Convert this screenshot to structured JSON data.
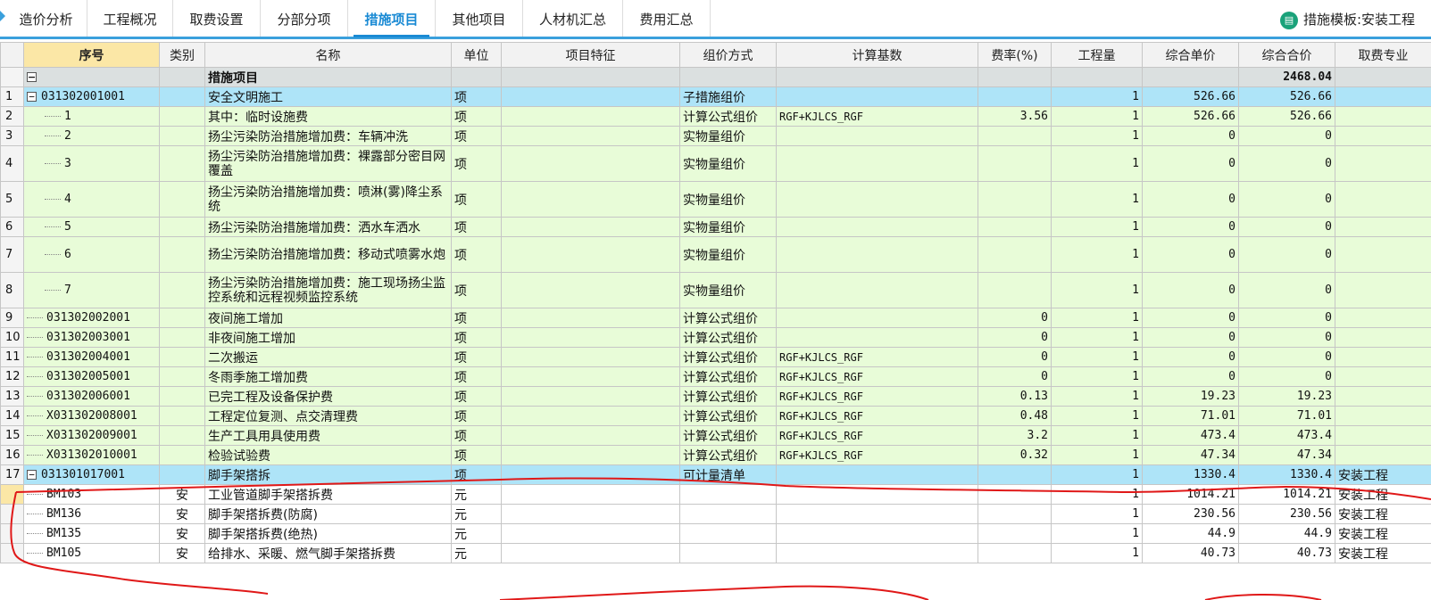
{
  "tabs": [
    "造价分析",
    "工程概况",
    "取费设置",
    "分部分项",
    "措施项目",
    "其他项目",
    "人材机汇总",
    "费用汇总"
  ],
  "active_tab": 4,
  "template_label": "措施模板:安装工程",
  "columns": [
    "序号",
    "类别",
    "名称",
    "单位",
    "项目特征",
    "组价方式",
    "计算基数",
    "费率(%)",
    "工程量",
    "综合单价",
    "综合合价",
    "取费专业"
  ],
  "header_row": {
    "name": "措施项目",
    "total": "2468.04"
  },
  "rows": [
    {
      "rn": "1",
      "code": "031302001001",
      "cat": "",
      "name": "安全文明施工",
      "unit": "项",
      "method": "子措施组价",
      "base": "",
      "rate": "",
      "qty": "1",
      "price": "526.66",
      "total": "526.66",
      "major": ""
    },
    {
      "rn": "2",
      "code": "1",
      "cat": "",
      "name": "其中：临时设施费",
      "unit": "项",
      "method": "计算公式组价",
      "base": "RGF+KJLCS_RGF",
      "rate": "3.56",
      "qty": "1",
      "price": "526.66",
      "total": "526.66",
      "major": ""
    },
    {
      "rn": "3",
      "code": "2",
      "cat": "",
      "name": "扬尘污染防治措施增加费：车辆冲洗",
      "unit": "项",
      "method": "实物量组价",
      "base": "",
      "rate": "",
      "qty": "1",
      "price": "0",
      "total": "0",
      "major": ""
    },
    {
      "rn": "4",
      "code": "3",
      "cat": "",
      "name": "扬尘污染防治措施增加费：裸露部分密目网覆盖",
      "unit": "项",
      "method": "实物量组价",
      "base": "",
      "rate": "",
      "qty": "1",
      "price": "0",
      "total": "0",
      "major": ""
    },
    {
      "rn": "5",
      "code": "4",
      "cat": "",
      "name": "扬尘污染防治措施增加费：喷淋(雾)降尘系统",
      "unit": "项",
      "method": "实物量组价",
      "base": "",
      "rate": "",
      "qty": "1",
      "price": "0",
      "total": "0",
      "major": ""
    },
    {
      "rn": "6",
      "code": "5",
      "cat": "",
      "name": "扬尘污染防治措施增加费：洒水车洒水",
      "unit": "项",
      "method": "实物量组价",
      "base": "",
      "rate": "",
      "qty": "1",
      "price": "0",
      "total": "0",
      "major": ""
    },
    {
      "rn": "7",
      "code": "6",
      "cat": "",
      "name": "扬尘污染防治措施增加费：移动式喷雾水炮",
      "unit": "项",
      "method": "实物量组价",
      "base": "",
      "rate": "",
      "qty": "1",
      "price": "0",
      "total": "0",
      "major": ""
    },
    {
      "rn": "8",
      "code": "7",
      "cat": "",
      "name": "扬尘污染防治措施增加费：施工现场扬尘监控系统和远程视频监控系统",
      "unit": "项",
      "method": "实物量组价",
      "base": "",
      "rate": "",
      "qty": "1",
      "price": "0",
      "total": "0",
      "major": ""
    },
    {
      "rn": "9",
      "code": "031302002001",
      "cat": "",
      "name": "夜间施工增加",
      "unit": "项",
      "method": "计算公式组价",
      "base": "",
      "rate": "0",
      "qty": "1",
      "price": "0",
      "total": "0",
      "major": ""
    },
    {
      "rn": "10",
      "code": "031302003001",
      "cat": "",
      "name": "非夜间施工增加",
      "unit": "项",
      "method": "计算公式组价",
      "base": "",
      "rate": "0",
      "qty": "1",
      "price": "0",
      "total": "0",
      "major": ""
    },
    {
      "rn": "11",
      "code": "031302004001",
      "cat": "",
      "name": "二次搬运",
      "unit": "项",
      "method": "计算公式组价",
      "base": "RGF+KJLCS_RGF",
      "rate": "0",
      "qty": "1",
      "price": "0",
      "total": "0",
      "major": ""
    },
    {
      "rn": "12",
      "code": "031302005001",
      "cat": "",
      "name": "冬雨季施工增加费",
      "unit": "项",
      "method": "计算公式组价",
      "base": "RGF+KJLCS_RGF",
      "rate": "0",
      "qty": "1",
      "price": "0",
      "total": "0",
      "major": ""
    },
    {
      "rn": "13",
      "code": "031302006001",
      "cat": "",
      "name": "已完工程及设备保护费",
      "unit": "项",
      "method": "计算公式组价",
      "base": "RGF+KJLCS_RGF",
      "rate": "0.13",
      "qty": "1",
      "price": "19.23",
      "total": "19.23",
      "major": ""
    },
    {
      "rn": "14",
      "code": "X031302008001",
      "cat": "",
      "name": "工程定位复测、点交清理费",
      "unit": "项",
      "method": "计算公式组价",
      "base": "RGF+KJLCS_RGF",
      "rate": "0.48",
      "qty": "1",
      "price": "71.01",
      "total": "71.01",
      "major": ""
    },
    {
      "rn": "15",
      "code": "X031302009001",
      "cat": "",
      "name": "生产工具用具使用费",
      "unit": "项",
      "method": "计算公式组价",
      "base": "RGF+KJLCS_RGF",
      "rate": "3.2",
      "qty": "1",
      "price": "473.4",
      "total": "473.4",
      "major": ""
    },
    {
      "rn": "16",
      "code": "X031302010001",
      "cat": "",
      "name": "检验试验费",
      "unit": "项",
      "method": "计算公式组价",
      "base": "RGF+KJLCS_RGF",
      "rate": "0.32",
      "qty": "1",
      "price": "47.34",
      "total": "47.34",
      "major": ""
    },
    {
      "rn": "17",
      "code": "031301017001",
      "cat": "",
      "name": "脚手架搭拆",
      "unit": "项",
      "method": "可计量清单",
      "base": "",
      "rate": "",
      "qty": "1",
      "price": "1330.4",
      "total": "1330.4",
      "major": "安装工程"
    },
    {
      "rn": "",
      "code": "BM103",
      "cat": "安",
      "name": "工业管道脚手架搭拆费",
      "unit": "元",
      "method": "",
      "base": "",
      "rate": "",
      "qty": "1",
      "price": "1014.21",
      "total": "1014.21",
      "major": "安装工程"
    },
    {
      "rn": "",
      "code": "BM136",
      "cat": "安",
      "name": "脚手架搭拆费(防腐)",
      "unit": "元",
      "method": "",
      "base": "",
      "rate": "",
      "qty": "1",
      "price": "230.56",
      "total": "230.56",
      "major": "安装工程"
    },
    {
      "rn": "",
      "code": "BM135",
      "cat": "安",
      "name": "脚手架搭拆费(绝热)",
      "unit": "元",
      "method": "",
      "base": "",
      "rate": "",
      "qty": "1",
      "price": "44.9",
      "total": "44.9",
      "major": "安装工程"
    },
    {
      "rn": "",
      "code": "BM105",
      "cat": "安",
      "name": "给排水、采暖、燃气脚手架搭拆费",
      "unit": "元",
      "method": "",
      "base": "",
      "rate": "",
      "qty": "1",
      "price": "40.73",
      "total": "40.73",
      "major": "安装工程"
    }
  ],
  "colors": {
    "accent": "#1a8ad4",
    "blue_row": "#aee4f8",
    "green_row": "#e8fcd8",
    "header_sel": "#fbe7a6",
    "annotation": "#e01818"
  }
}
